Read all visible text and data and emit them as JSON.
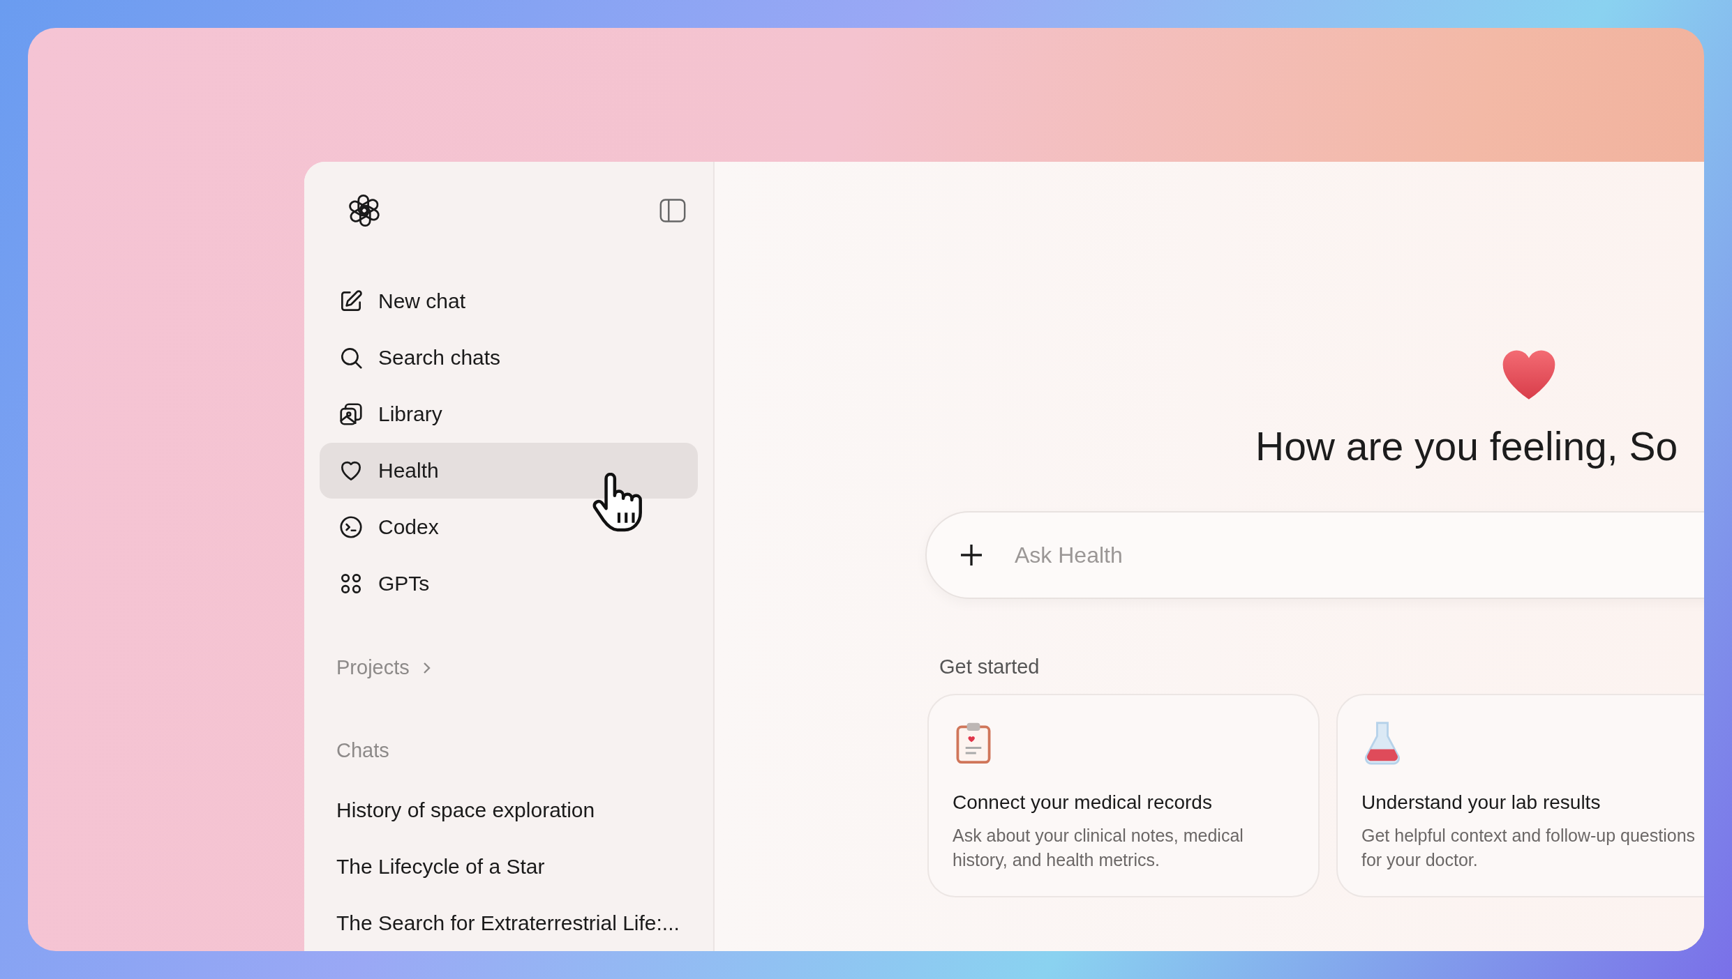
{
  "sidebar": {
    "nav": [
      {
        "label": "New chat",
        "selected": false
      },
      {
        "label": "Search chats",
        "selected": false
      },
      {
        "label": "Library",
        "selected": false
      },
      {
        "label": "Health",
        "selected": true
      },
      {
        "label": "Codex",
        "selected": false
      },
      {
        "label": "GPTs",
        "selected": false
      }
    ],
    "projects": "Projects",
    "chats_heading": "Chats",
    "chats": [
      "History of space exploration",
      "The Lifecycle of a Star",
      "The Search for Extraterrestrial Life:..."
    ]
  },
  "main": {
    "heading": "How are you feeling, So",
    "composer": {
      "placeholder": "Ask Health"
    },
    "get_started": "Get started",
    "cards": [
      {
        "title": "Connect your medical records",
        "description": "Ask about your clinical notes, medical history, and health metrics."
      },
      {
        "title": "Understand your lab results",
        "description": "Get helpful context and follow-up questions for your doctor."
      }
    ]
  }
}
